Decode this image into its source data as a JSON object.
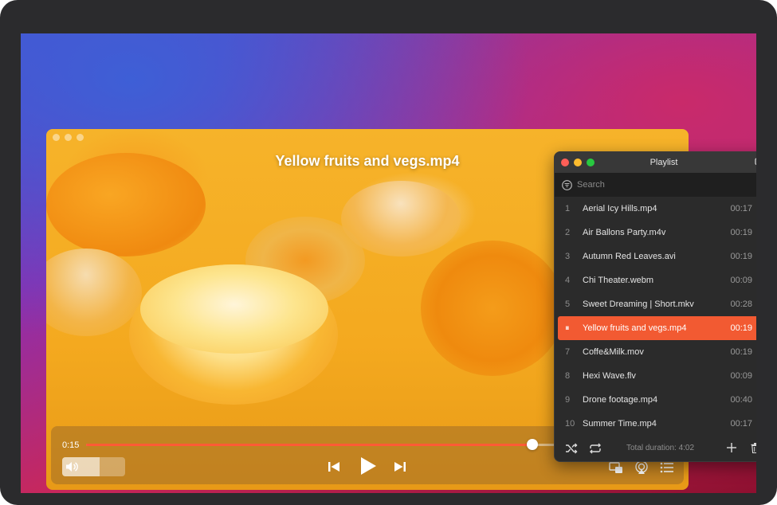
{
  "video": {
    "title": "Yellow fruits and vegs.mp4"
  },
  "controls": {
    "current_time": "0:15",
    "progress_fraction": 0.8,
    "volume_fraction": 0.6
  },
  "playlist": {
    "title": "Playlist",
    "search_placeholder": "Search",
    "items": [
      {
        "num": "1",
        "name": "Aerial Icy Hills.mp4",
        "duration": "00:17"
      },
      {
        "num": "2",
        "name": "Air Ballons Party.m4v",
        "duration": "00:19"
      },
      {
        "num": "3",
        "name": "Autumn Red Leaves.avi",
        "duration": "00:19"
      },
      {
        "num": "4",
        "name": "Chi Theater.webm",
        "duration": "00:09"
      },
      {
        "num": "5",
        "name": "Sweet Dreaming | Short.mkv",
        "duration": "00:28"
      },
      {
        "num": "⏸",
        "name": "Yellow fruits and vegs.mp4",
        "duration": "00:19",
        "active": true
      },
      {
        "num": "7",
        "name": "Coffe&Milk.mov",
        "duration": "00:19"
      },
      {
        "num": "8",
        "name": "Hexi Wave.flv",
        "duration": "00:09"
      },
      {
        "num": "9",
        "name": "Drone footage.mp4",
        "duration": "00:40"
      },
      {
        "num": "10",
        "name": "Summer Time.mp4",
        "duration": "00:17"
      }
    ],
    "total_duration": "Total duration: 4:02"
  },
  "colors": {
    "accent": "#f25a32",
    "progress": "#ff5a36"
  }
}
